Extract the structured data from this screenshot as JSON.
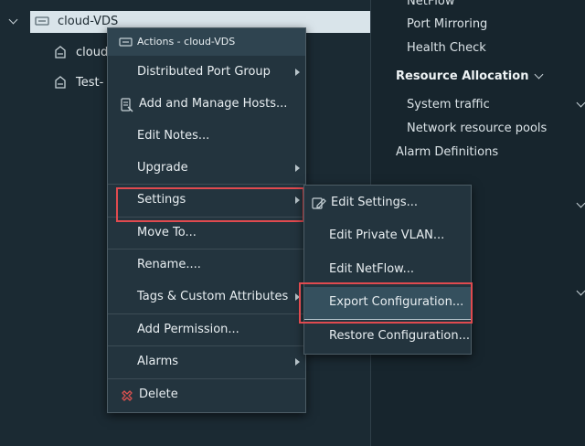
{
  "tree": {
    "root_label": "cloud-VDS",
    "child1_label": "cloud",
    "child2_label": "Test-"
  },
  "right_panel": {
    "items": [
      "NetFlow",
      "Port Mirroring",
      "Health Check"
    ],
    "section_heading": "Resource Allocation",
    "section_items": [
      "System traffic",
      "Network resource pools"
    ],
    "alarm_definitions": "Alarm Definitions"
  },
  "context_menu": {
    "header": "Actions - cloud-VDS",
    "items": {
      "distributed_port_group": "Distributed Port Group",
      "add_manage_hosts": "Add and Manage Hosts...",
      "edit_notes": "Edit Notes...",
      "upgrade": "Upgrade",
      "settings": "Settings",
      "move_to": "Move To...",
      "rename": "Rename....",
      "tags": "Tags & Custom Attributes",
      "add_permission": "Add Permission...",
      "alarms": "Alarms",
      "delete": "Delete"
    }
  },
  "settings_submenu": {
    "edit_settings": "Edit Settings...",
    "edit_private_vlan": "Edit Private VLAN...",
    "edit_netflow": "Edit NetFlow...",
    "export_configuration": "Export Configuration...",
    "restore_configuration": "Restore Configuration..."
  },
  "colors": {
    "highlight_border": "#e04a4f",
    "menu_bg": "#23343e",
    "selected_row_bg": "#d9e4ea",
    "delete_icon": "#e0524f"
  },
  "icons": [
    "chevron-down-icon",
    "vds-switch-icon",
    "port-group-icon",
    "actions-menu-icon",
    "hosts-icon",
    "delete-icon",
    "edit-settings-icon",
    "chevron-right-icon"
  ]
}
